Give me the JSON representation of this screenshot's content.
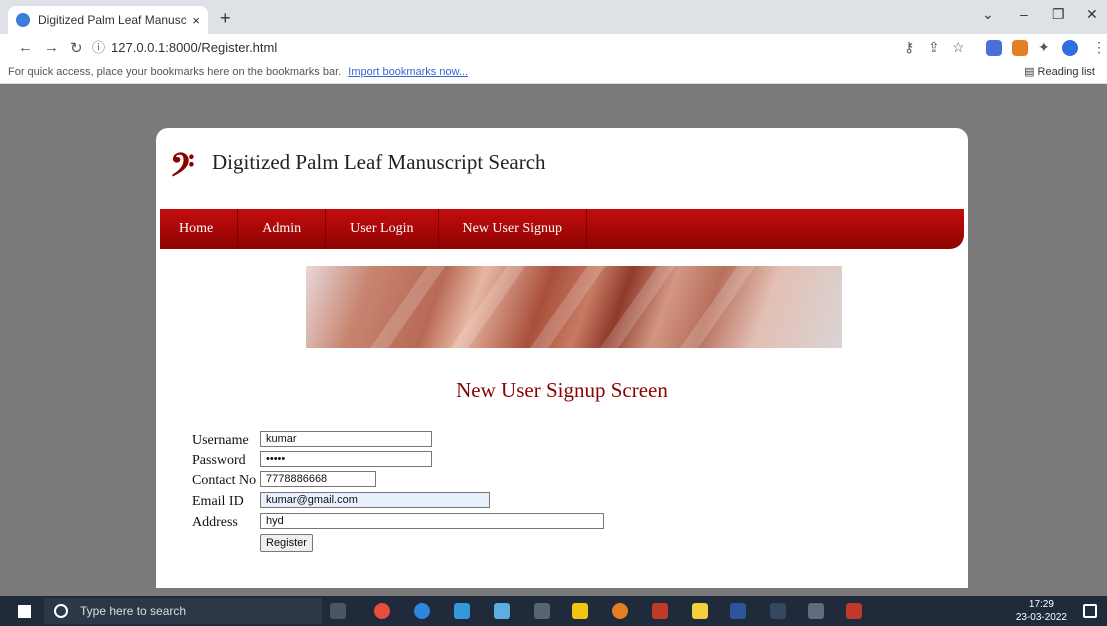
{
  "browser": {
    "tab_title": "Digitized Palm Leaf Manuscript S",
    "close_glyph": "×",
    "new_tab_glyph": "+",
    "url_info": "ⓘ",
    "url": "127.0.0.1:8000/Register.html",
    "bookmarks_text": "For quick access, place your bookmarks here on the bookmarks bar.",
    "import_link": "Import bookmarks now...",
    "reading_list": "Reading list"
  },
  "site": {
    "logo_glyph": "𝄢",
    "title": "Digitized Palm Leaf Manuscript Search",
    "menu": [
      "Home",
      "Admin",
      "User Login",
      "New User Signup"
    ]
  },
  "screen_title": "New User Signup Screen",
  "form": {
    "username_label": "Username",
    "username_value": "kumar",
    "password_label": "Password",
    "password_value": "•••••",
    "contact_label": "Contact No",
    "contact_value": "7778886668",
    "email_label": "Email ID",
    "email_value": "kumar@gmail.com",
    "address_label": "Address",
    "address_value": "hyd",
    "submit_label": "Register"
  },
  "taskbar": {
    "search_placeholder": "Type here to search",
    "time": "17:29",
    "date": "23-03-2022"
  },
  "colors": {
    "brand_red": "#8b0000",
    "menu_red": "#c40d0d"
  }
}
